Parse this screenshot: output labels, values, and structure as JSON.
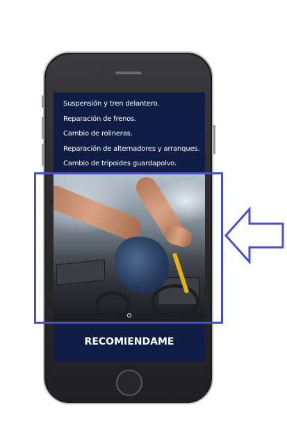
{
  "services": [
    "Suspensión y tren delantero.",
    "Reparación de frenos.",
    "Cambio de rolineras.",
    "Reparación de alternadores y arranques.",
    "Cambio de tripoides guardapolvo."
  ],
  "cta": {
    "label": "RECOMIENDAME"
  },
  "image": {
    "icon": "mechanic-engine-photo"
  },
  "annotations": {
    "highlight_color": "#4a4fc9",
    "arrow_color": "#4a4fc9",
    "arrow_direction": "left"
  },
  "colors": {
    "screen_bg": "#0f1d44",
    "text": "#ffffff"
  }
}
